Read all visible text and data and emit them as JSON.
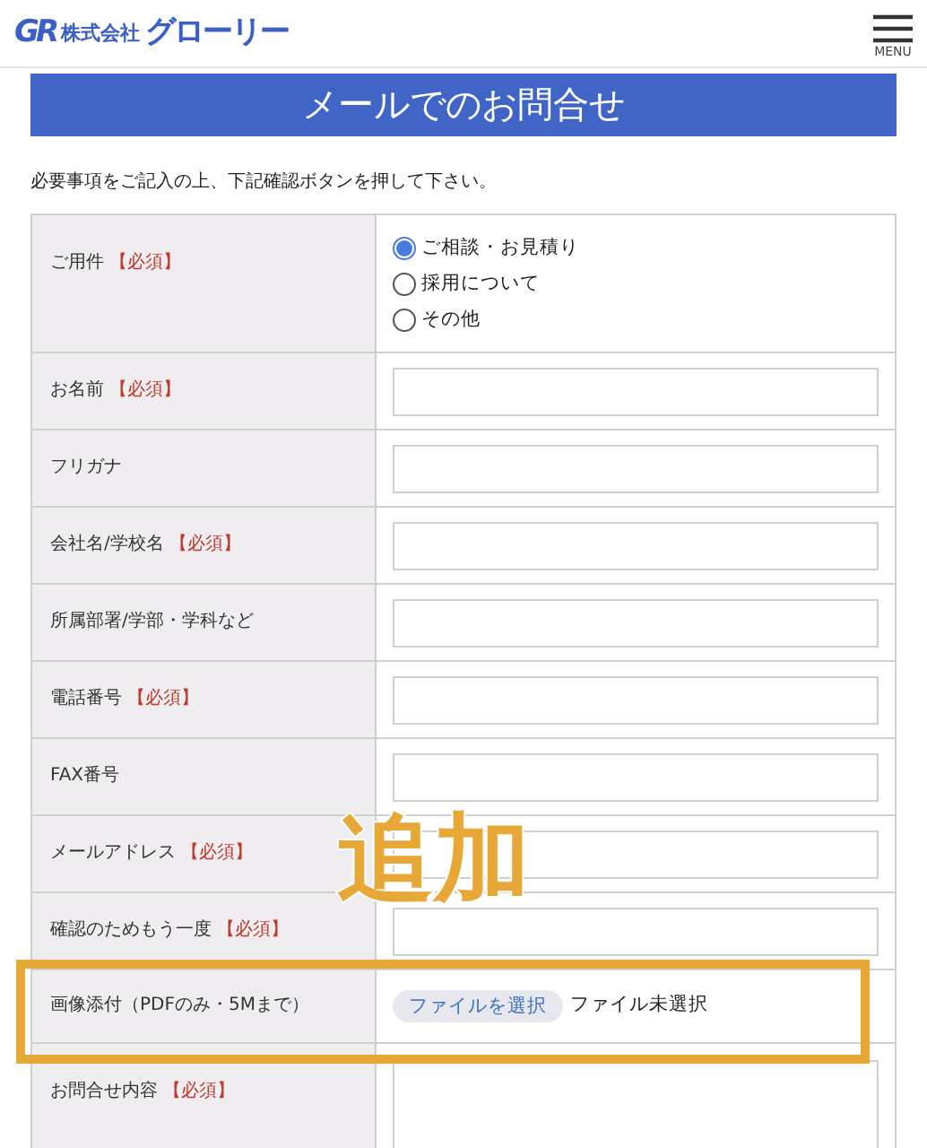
{
  "header": {
    "logo_mark": "GR",
    "company_prefix": "株式会社",
    "company_name": "グローリー",
    "menu_label": "MENU"
  },
  "title": "メールでのお問合せ",
  "instructions": "必要事項をご記入の上、下記確認ボタンを押して下さい。",
  "fields": [
    {
      "kind": "radio",
      "label": "ご用件",
      "required_mark": "【必須】",
      "options": [
        {
          "label": "ご相談・お見積り",
          "selected": true
        },
        {
          "label": "採用について",
          "selected": false
        },
        {
          "label": "その他",
          "selected": false
        }
      ]
    },
    {
      "kind": "text",
      "label": "お名前",
      "required_mark": "【必須】"
    },
    {
      "kind": "text",
      "label": "フリガナ"
    },
    {
      "kind": "text",
      "label": "会社名/学校名",
      "required_mark": "【必須】"
    },
    {
      "kind": "text",
      "label": "所属部署/学部・学科など"
    },
    {
      "kind": "text",
      "label": "電話番号",
      "required_mark": "【必須】"
    },
    {
      "kind": "text",
      "label": "FAX番号"
    },
    {
      "kind": "text",
      "label": "メールアドレス",
      "required_mark": "【必須】"
    },
    {
      "kind": "text",
      "label": "確認のためもう一度",
      "required_mark": "【必須】"
    },
    {
      "kind": "file",
      "label": "画像添付（PDFのみ・5Mまで）",
      "button": "ファイルを選択",
      "status": "ファイル未選択",
      "highlighted": true
    },
    {
      "kind": "textarea",
      "label": "お問合せ内容",
      "required_mark": "【必須】"
    }
  ],
  "annotation": {
    "text": "追加"
  }
}
